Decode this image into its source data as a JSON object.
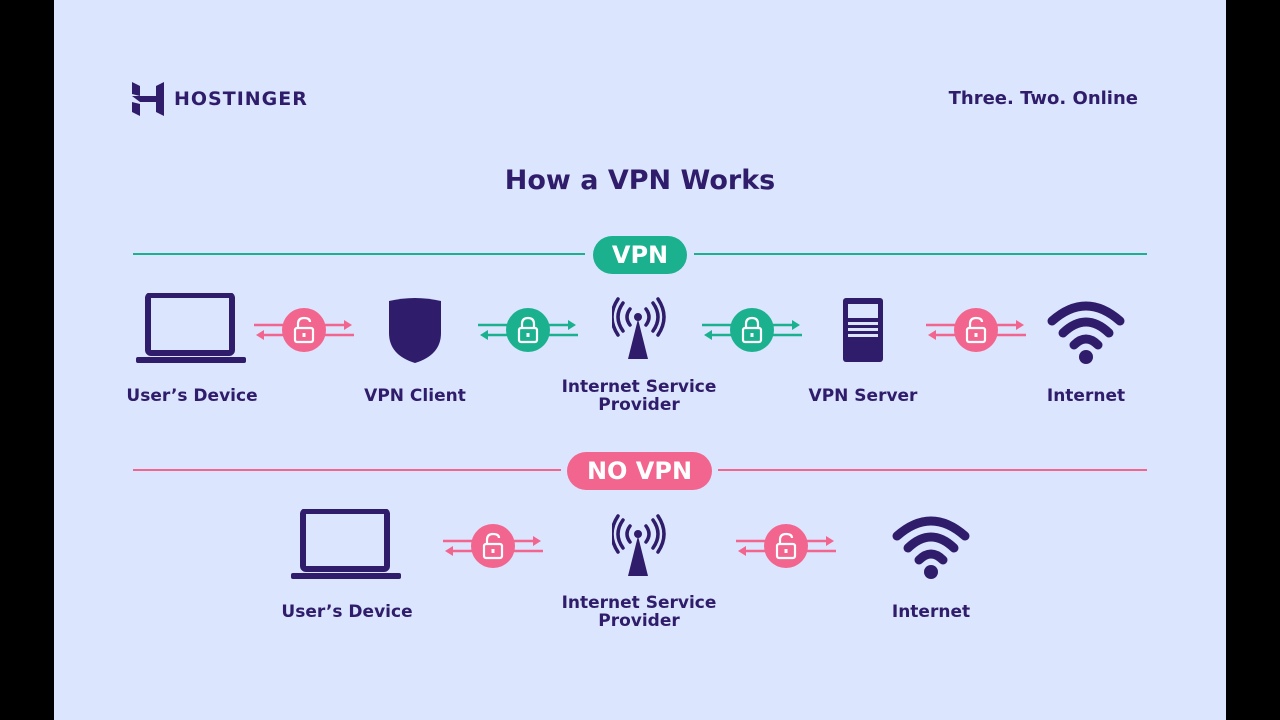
{
  "brand": {
    "name": "HOSTINGER",
    "tagline": "Three. Two. Online"
  },
  "title": "How a VPN Works",
  "colors": {
    "background": "#dbe5fd",
    "navy": "#2f1c6a",
    "vpn_green": "#1bb18f",
    "novpn_pink": "#f2658e"
  },
  "vpn_section": {
    "label": "VPN",
    "nodes": [
      {
        "icon": "laptop-icon",
        "label": "User’s Device"
      },
      {
        "icon": "shield-icon",
        "label": "VPN Client"
      },
      {
        "icon": "cell-tower-icon",
        "label": "Internet Service Provider"
      },
      {
        "icon": "server-icon",
        "label": "VPN Server"
      },
      {
        "icon": "wifi-icon",
        "label": "Internet"
      }
    ],
    "links": [
      {
        "lock": "unlocked",
        "color": "pink"
      },
      {
        "lock": "locked",
        "color": "green"
      },
      {
        "lock": "locked",
        "color": "green"
      },
      {
        "lock": "unlocked",
        "color": "pink"
      }
    ]
  },
  "novpn_section": {
    "label": "NO VPN",
    "nodes": [
      {
        "icon": "laptop-icon",
        "label": "User’s Device"
      },
      {
        "icon": "cell-tower-icon",
        "label": "Internet Service Provider"
      },
      {
        "icon": "wifi-icon",
        "label": "Internet"
      }
    ],
    "links": [
      {
        "lock": "unlocked",
        "color": "pink"
      },
      {
        "lock": "unlocked",
        "color": "pink"
      }
    ]
  }
}
